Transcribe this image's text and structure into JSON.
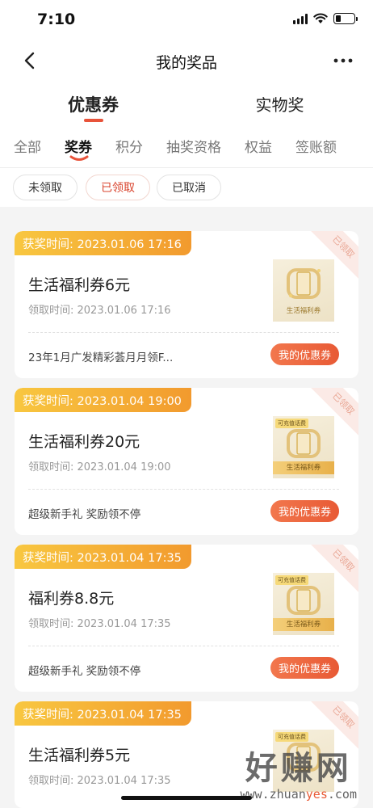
{
  "status_bar": {
    "time": "7:10",
    "battery_level": 0.3
  },
  "nav": {
    "title": "我的奖品"
  },
  "main_tabs": [
    {
      "label": "优惠券",
      "active": true
    },
    {
      "label": "实物奖",
      "active": false
    }
  ],
  "sub_tabs": [
    {
      "label": "全部",
      "active": false
    },
    {
      "label": "奖券",
      "active": true
    },
    {
      "label": "积分",
      "active": false
    },
    {
      "label": "抽奖资格",
      "active": false
    },
    {
      "label": "权益",
      "active": false
    },
    {
      "label": "签账额",
      "active": false
    }
  ],
  "filters": [
    {
      "label": "未领取",
      "active": false
    },
    {
      "label": "已领取",
      "active": true
    },
    {
      "label": "已取消",
      "active": false
    }
  ],
  "cards": [
    {
      "award_time": "获奖时间: 2023.01.06 17:16",
      "ribbon": "已领取",
      "title": "生活福利券6元",
      "claim_time": "领取时间: 2023.01.06 17:16",
      "desc": "23年1月广发精彩荟月月领F...",
      "button": "我的优惠券",
      "thumb_tag": "",
      "thumb_label": "生活福利券"
    },
    {
      "award_time": "获奖时间: 2023.01.04 19:00",
      "ribbon": "已领取",
      "title": "生活福利券20元",
      "claim_time": "领取时间: 2023.01.04 19:00",
      "desc": "超级新手礼 奖励领不停",
      "button": "我的优惠券",
      "thumb_tag": "可充值话费",
      "thumb_label": "生活福利券"
    },
    {
      "award_time": "获奖时间: 2023.01.04 17:35",
      "ribbon": "已领取",
      "title": "福利券8.8元",
      "claim_time": "领取时间: 2023.01.04 17:35",
      "desc": "超级新手礼 奖励领不停",
      "button": "我的优惠券",
      "thumb_tag": "可充值话费",
      "thumb_label": "生活福利券"
    },
    {
      "award_time": "获奖时间: 2023.01.04 17:35",
      "ribbon": "已领取",
      "title": "生活福利券5元",
      "claim_time": "领取时间: 2023.01.04 17:35",
      "desc": "",
      "button": "",
      "thumb_tag": "可充值话费",
      "thumb_label": ""
    }
  ],
  "watermark": {
    "main": "好赚网",
    "sub_prefix": "www.zhuan",
    "sub_highlight": "yes",
    "sub_suffix": ".com"
  },
  "colors": {
    "accent": "#e8533a",
    "banner_start": "#f8c740",
    "banner_end": "#f29a2e",
    "button": "#e85a35"
  }
}
